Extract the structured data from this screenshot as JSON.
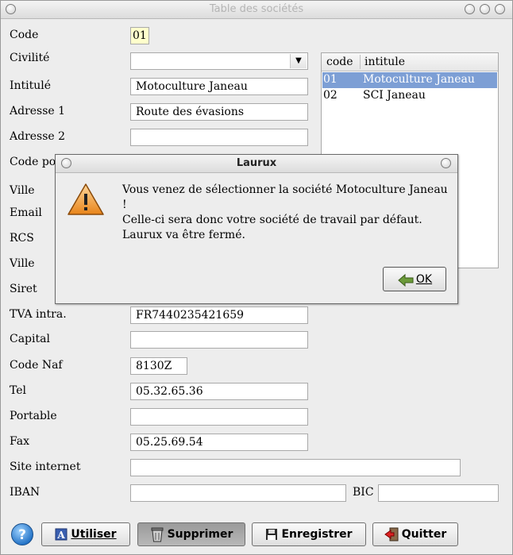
{
  "window": {
    "title": "Table des sociétés"
  },
  "form": {
    "code_label": "Code",
    "code_value": "01",
    "civilite_label": "Civilité",
    "civilite_value": "",
    "intitule_label": "Intitulé",
    "intitule_value": "Motoculture Janeau",
    "adresse1_label": "Adresse 1",
    "adresse1_value": "Route des évasions",
    "adresse2_label": "Adresse 2",
    "adresse2_value": "",
    "codepostal_label": "Code po",
    "ville_label": "Ville",
    "email_label": "Email",
    "rcs_label": "RCS",
    "ville2_label": "Ville",
    "siret_label": "Siret",
    "tva_label": "TVA intra.",
    "tva_value": "FR7440235421659",
    "capital_label": "Capital",
    "capital_value": "",
    "codenaf_label": "Code Naf",
    "codenaf_value": "8130Z",
    "tel_label": "Tel",
    "tel_value": "05.32.65.36",
    "portable_label": "Portable",
    "portable_value": "",
    "fax_label": "Fax",
    "fax_value": "05.25.69.54",
    "site_label": "Site internet",
    "site_value": "",
    "iban_label": "IBAN",
    "iban_value": "",
    "bic_label": "BIC",
    "bic_value": ""
  },
  "list": {
    "columns": [
      "code",
      "intitule"
    ],
    "rows": [
      {
        "code": "01",
        "intitule": "Motoculture Janeau",
        "selected": true
      },
      {
        "code": "02",
        "intitule": "SCI Janeau",
        "selected": false
      }
    ]
  },
  "buttons": {
    "help_icon": "question-icon",
    "utiliser": "Utiliser",
    "supprimer": "Supprimer",
    "enregistrer": "Enregistrer",
    "quitter": "Quitter"
  },
  "dialog": {
    "title": "Laurux",
    "icon": "warning-icon",
    "line1": " Vous venez de sélectionner la société  Motoculture Janeau !",
    "line2": " Celle-ci sera donc votre société de travail par défaut.",
    "line3": " Laurux va être fermé.",
    "ok": "OK"
  },
  "colors": {
    "selection": "#7d9fd5",
    "code_field": "#ffffcc"
  }
}
